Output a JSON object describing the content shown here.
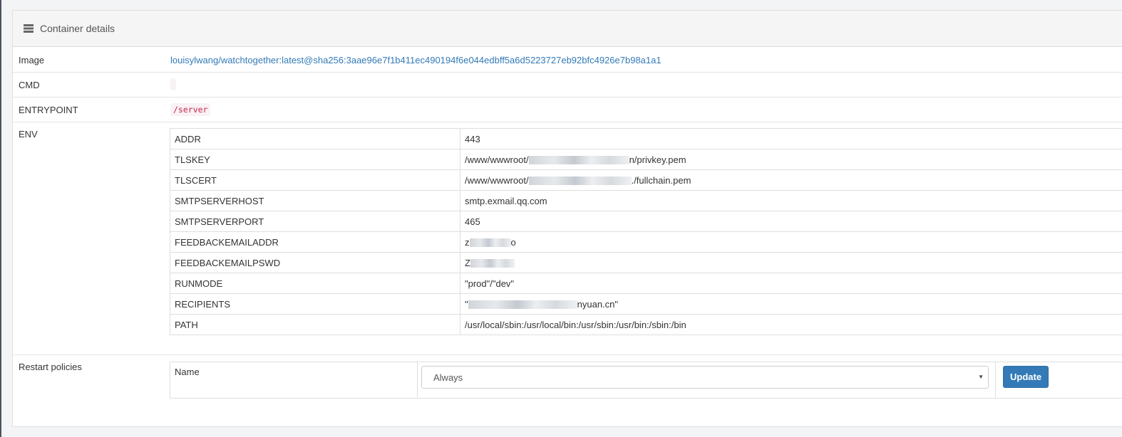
{
  "panel": {
    "title": "Container details",
    "icon": "list-icon"
  },
  "image": {
    "label": "Image",
    "value": "louisylwang/watchtogether:latest@sha256:3aae96e7f1b411ec490194f6e044edbff5a6d5223727eb92bfc4926e7b98a1a1"
  },
  "cmd": {
    "label": "CMD",
    "value": ""
  },
  "entrypoint": {
    "label": "ENTRYPOINT",
    "value": "/server"
  },
  "env": {
    "label": "ENV",
    "rows": [
      {
        "key": "ADDR",
        "value_pre": "443",
        "value_post": ""
      },
      {
        "key": "TLSKEY",
        "value_pre": "/www/wwwroot/",
        "value_post": "n/privkey.pem"
      },
      {
        "key": "TLSCERT",
        "value_pre": "/www/wwwroot/",
        "value_post": "./fullchain.pem"
      },
      {
        "key": "SMTPSERVERHOST",
        "value_pre": "smtp.exmail.qq.com",
        "value_post": ""
      },
      {
        "key": "SMTPSERVERPORT",
        "value_pre": "465",
        "value_post": ""
      },
      {
        "key": "FEEDBACKEMAILADDR",
        "value_pre": "z",
        "value_post": "o"
      },
      {
        "key": "FEEDBACKEMAILPSWD",
        "value_pre": "Z",
        "value_post": ""
      },
      {
        "key": "RUNMODE",
        "value_pre": "\"prod\"/\"dev\"",
        "value_post": ""
      },
      {
        "key": "RECIPIENTS",
        "value_pre": "\"",
        "value_post": "nyuan.cn\""
      },
      {
        "key": "PATH",
        "value_pre": "/usr/local/sbin:/usr/local/bin:/usr/sbin:/usr/bin:/sbin:/bin",
        "value_post": ""
      }
    ]
  },
  "restart": {
    "label": "Restart policies",
    "name_label": "Name",
    "selected": "Always",
    "update_label": "Update"
  },
  "colors": {
    "link": "#337ab7",
    "code": "#c7254e",
    "button": "#337ab7"
  }
}
